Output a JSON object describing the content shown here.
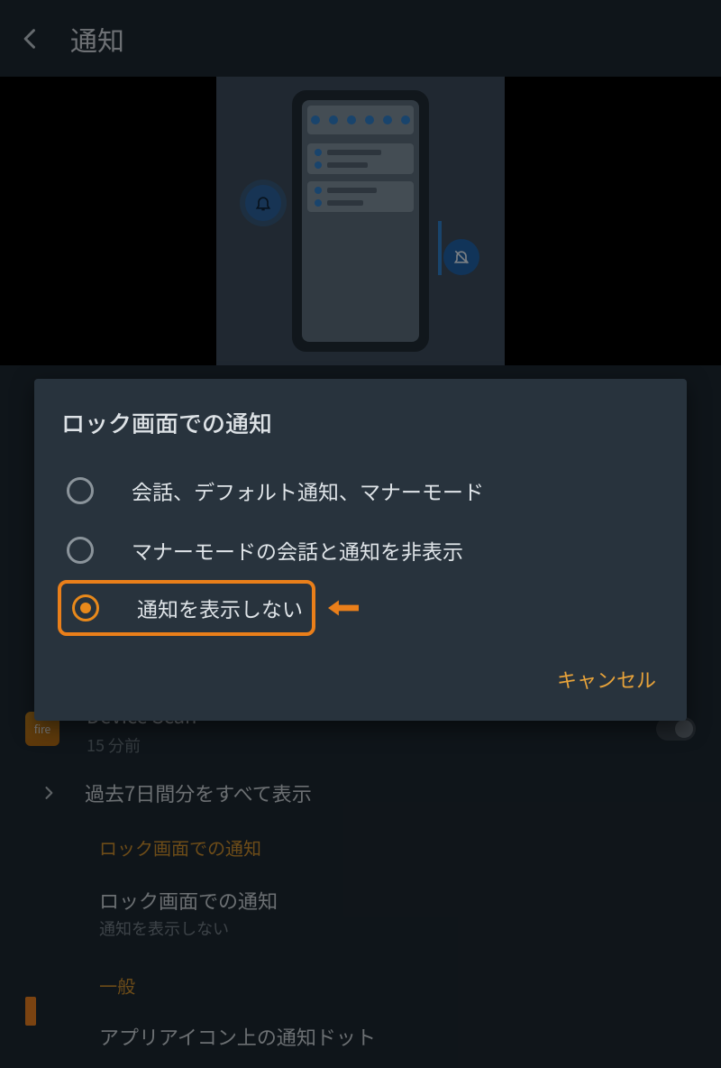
{
  "header": {
    "title": "通知"
  },
  "dialog": {
    "title": "ロック画面での通知",
    "options": [
      {
        "label": "会話、デフォルト通知、マナーモード",
        "selected": false
      },
      {
        "label": "マナーモードの会話と通知を非表示",
        "selected": false
      },
      {
        "label": "通知を表示しない",
        "selected": true
      }
    ],
    "cancel_label": "キャンセル"
  },
  "background": {
    "device_scan": {
      "title": "Device Scan",
      "subtitle": "15 分前",
      "app_icon_label": "fire"
    },
    "history_link": "過去7日間分をすべて表示",
    "section_header": "ロック画面での通知",
    "lock_setting": {
      "title": "ロック画面での通知",
      "subtitle": "通知を表示しない"
    },
    "general_header": "一般",
    "cut_off_row": "アプリアイコン上の通知ドット"
  }
}
